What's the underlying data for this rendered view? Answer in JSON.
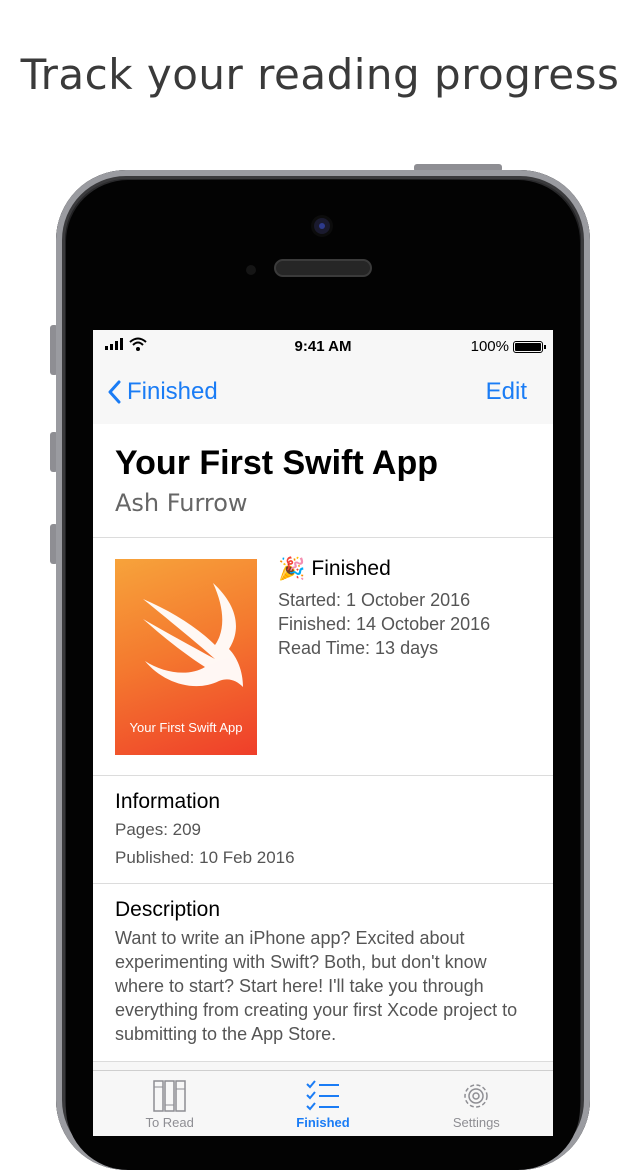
{
  "headline": "Track your reading progress",
  "status_bar": {
    "time": "9:41 AM",
    "battery": "100%"
  },
  "nav": {
    "back_label": "Finished",
    "edit_label": "Edit"
  },
  "book": {
    "title": "Your First Swift App",
    "author": "Ash Furrow",
    "cover_text": "Your First Swift App",
    "status": "Finished",
    "started": "Started: 1 October 2016",
    "finished": "Finished: 14 October 2016",
    "read_time": "Read Time: 13 days"
  },
  "information": {
    "heading": "Information",
    "pages": "Pages: 209",
    "published": "Published: 10 Feb 2016"
  },
  "description": {
    "heading": "Description",
    "text": "Want to write an iPhone app? Excited about experimenting with Swift? Both, but don't know where to start? Start here! I'll take you through everything from creating your first Xcode project to submitting to the App Store."
  },
  "tabs": [
    {
      "label": "To Read",
      "icon": "books-icon"
    },
    {
      "label": "Finished",
      "icon": "checklist-icon"
    },
    {
      "label": "Settings",
      "icon": "gear-icon"
    }
  ],
  "colors": {
    "accent": "#1a7cf5",
    "tab_inactive": "#8e8e93"
  }
}
